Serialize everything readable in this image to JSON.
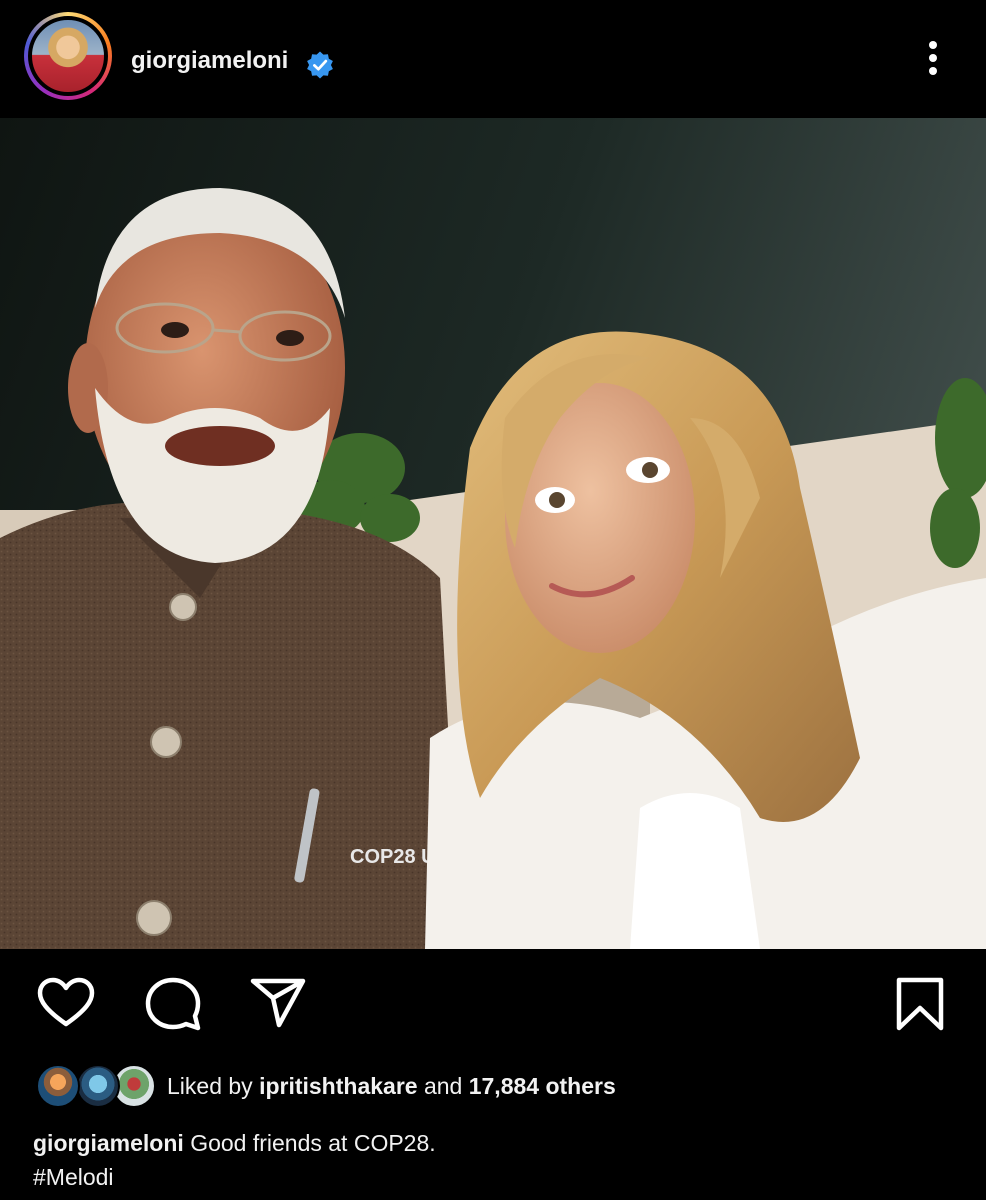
{
  "post": {
    "username": "giorgiameloni",
    "verified": true,
    "avatar_icon": "profile-avatar",
    "more_icon": "more-vertical-icon"
  },
  "image": {
    "pin_text": "COP28 UAE",
    "tag_icon": "user-tag-icon"
  },
  "actions": {
    "like_icon": "heart-icon",
    "comment_icon": "comment-icon",
    "share_icon": "send-icon",
    "save_icon": "bookmark-icon"
  },
  "likes": {
    "prefix": "Liked by ",
    "user": "ipritishthakare",
    "middle": " and ",
    "count": "17,884 others"
  },
  "caption": {
    "username": "giorgiameloni",
    "text": "Good friends at COP28.",
    "hashtag": "#Melodi"
  },
  "colors": {
    "background": "#000000",
    "verified_badge": "#3897f0",
    "text": "#f2f2f2"
  }
}
